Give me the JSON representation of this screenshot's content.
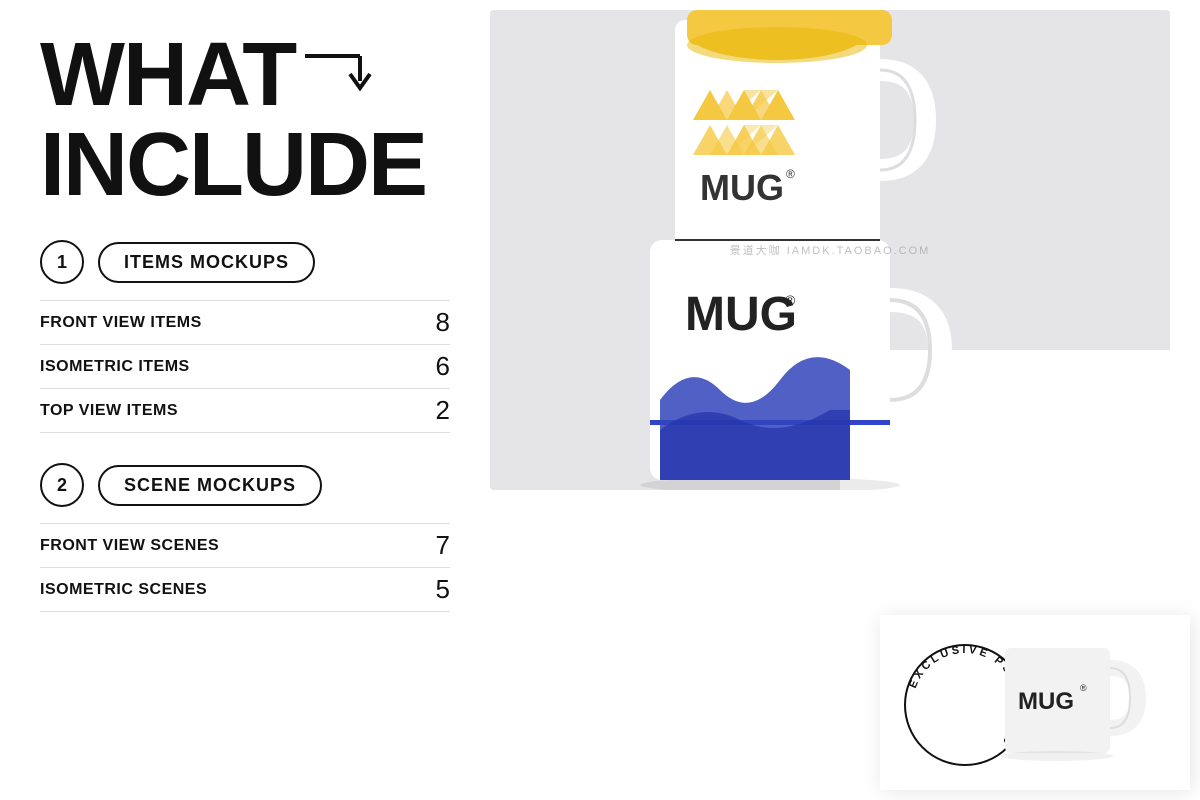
{
  "left": {
    "title_line1": "WHAT",
    "title_line2": "INCLUDE",
    "arrow": "→↓",
    "category1": {
      "number": "1",
      "label": "ITEMS MOCKUPS",
      "items": [
        {
          "name": "FRONT VIEW ITEMS",
          "count": "8"
        },
        {
          "name": "ISOMETRIC ITEMS",
          "count": "6"
        },
        {
          "name": "TOP VIEW ITEMS",
          "count": "2"
        }
      ]
    },
    "category2": {
      "number": "2",
      "label": "SCENE MOCKUPS",
      "items": [
        {
          "name": "FRONT VIEW SCENES",
          "count": "7"
        },
        {
          "name": "ISOMETRIC SCENES",
          "count": "5"
        }
      ]
    }
  },
  "right": {
    "mug_brand": "MUG",
    "mug_brand_small": "MUG",
    "reg_mark": "®",
    "stamp_text": "EXCLUSIVE PSD MOCKU",
    "watermark": "景道大咖  IAMDK.TAOBAO.COM"
  }
}
